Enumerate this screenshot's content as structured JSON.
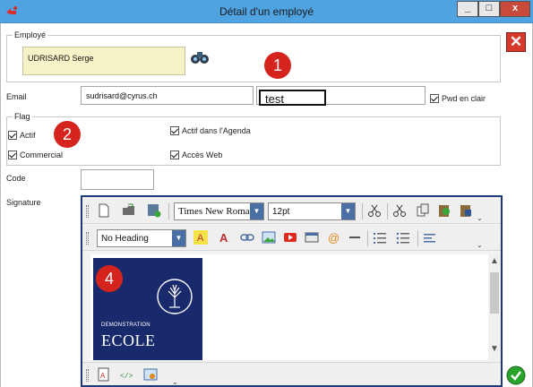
{
  "window": {
    "title": "Détail d'un employé",
    "min_label": "_",
    "max_label": "□",
    "close_label": "x"
  },
  "employe": {
    "legend": "Employé",
    "name": "UDRISARD Serge"
  },
  "email": {
    "label": "Email",
    "value": "sudrisard@cyrus.ch",
    "password_value": "test",
    "pwd_clear_label": "Pwd en clair"
  },
  "flag": {
    "legend": "Flag",
    "actif": "Actif",
    "commercial": "Commercial",
    "agenda": "Actif dans l'Agenda",
    "web": "Accès Web"
  },
  "code": {
    "label": "Code",
    "value": ""
  },
  "signature": {
    "label": "Signature",
    "font": "Times New Roman",
    "size": "12pt",
    "heading": "No Heading",
    "overflow": "⌄",
    "logo_line1": "DEMONSTRATION",
    "logo_line2": "ECOLE"
  },
  "markers": [
    "1",
    "2",
    "4"
  ],
  "colors": {
    "titlebar": "#4fa3e0",
    "editor_border": "#1f3a7a",
    "logo_bg": "#182a6b",
    "marker": "#d5241d",
    "ok": "#2aa32a",
    "close": "#d53a2c"
  }
}
